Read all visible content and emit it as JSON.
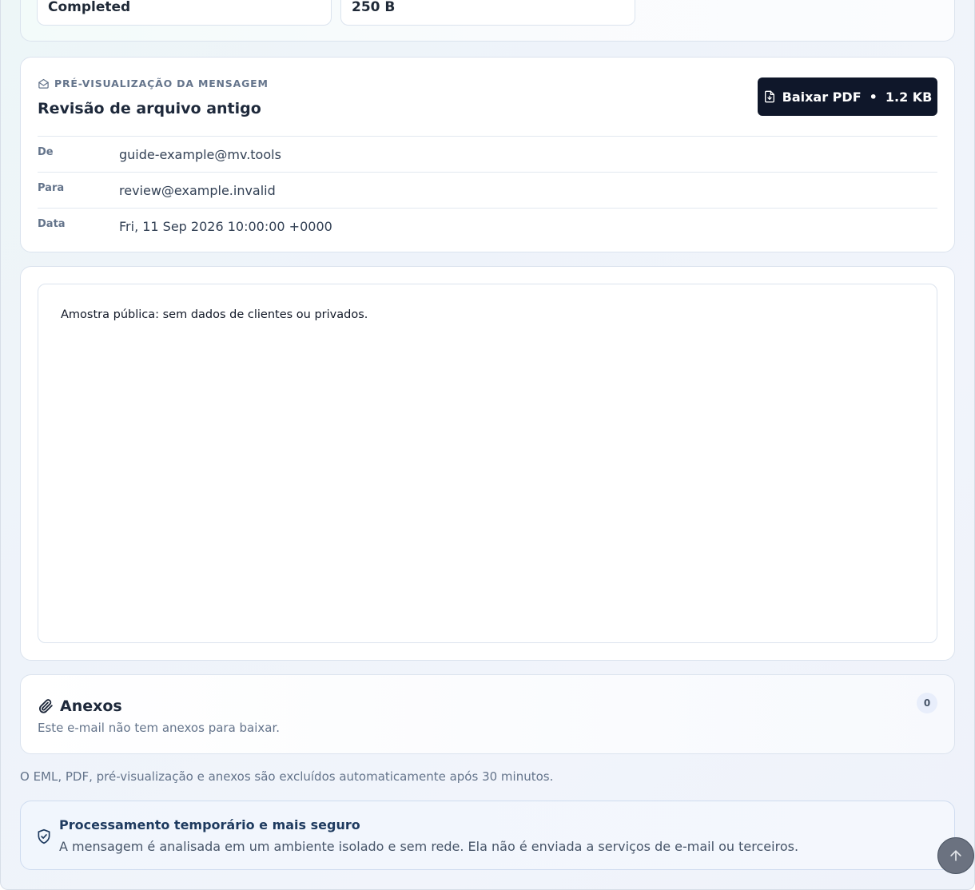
{
  "status": {
    "state_value": "Completed",
    "size_value": "250 B"
  },
  "preview": {
    "eyebrow": "PRÉ-VISUALIZAÇÃO DA MENSAGEM",
    "subject": "Revisão de arquivo antigo",
    "pdf_button": {
      "label": "Baixar PDF",
      "separator": "•",
      "size": "1.2 KB",
      "icon": "file-download-icon"
    },
    "meta": [
      {
        "key": "De",
        "value": "guide-example@mv.tools"
      },
      {
        "key": "Para",
        "value": "review@example.invalid"
      },
      {
        "key": "Data",
        "value": "Fri, 11 Sep 2026 10:00:00 +0000"
      }
    ]
  },
  "body": {
    "text": "Amostra pública: sem dados de clientes ou privados."
  },
  "attachments": {
    "title": "Anexos",
    "subtitle": "Este e-mail não tem anexos para baixar.",
    "count": "0",
    "icon": "paperclip-icon"
  },
  "retention_note": "O EML, PDF, pré-visualização e anexos são excluídos automaticamente após 30 minutos.",
  "security": {
    "title": "Processamento temporário e mais seguro",
    "text": "A mensagem é analisada em um ambiente isolado e sem rede. Ela não é enviada a serviços de e-mail ou terceiros.",
    "icon": "shield-check-icon"
  },
  "scroll_top": {
    "icon": "arrow-up-icon"
  },
  "colors": {
    "primary_button": "#0f172a",
    "accent_text": "#1e3a5f",
    "muted_text": "#64748b"
  }
}
